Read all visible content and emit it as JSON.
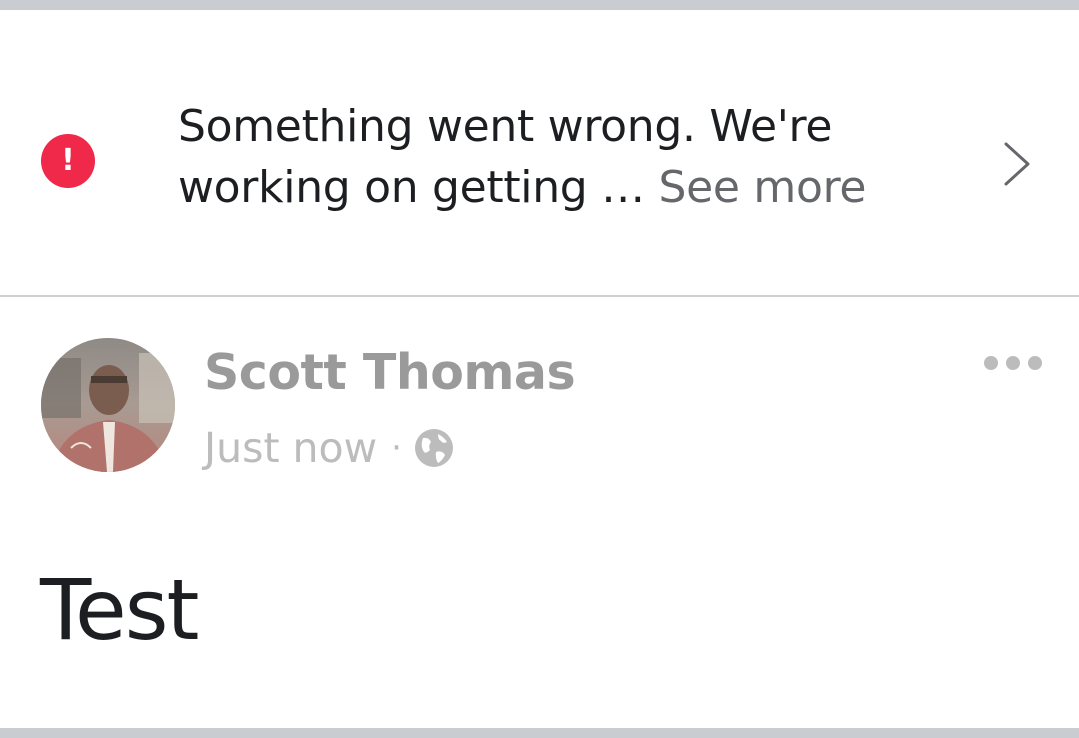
{
  "error_banner": {
    "icon": "exclamation-icon",
    "icon_glyph": "!",
    "message": "Something went wrong. We're working on getting …",
    "see_more_label": "See more",
    "chevron": "chevron-right-icon",
    "accent_color": "#f02849"
  },
  "post": {
    "author_name": "Scott Thomas",
    "timestamp": "Just now",
    "separator": "·",
    "privacy_icon": "globe-icon",
    "more_options_icon": "more-horizontal-icon",
    "body_text": "Test"
  },
  "colors": {
    "divider": "#ced0d4",
    "bar": "#c9ccd1",
    "muted_text": "#9a9a9a"
  }
}
